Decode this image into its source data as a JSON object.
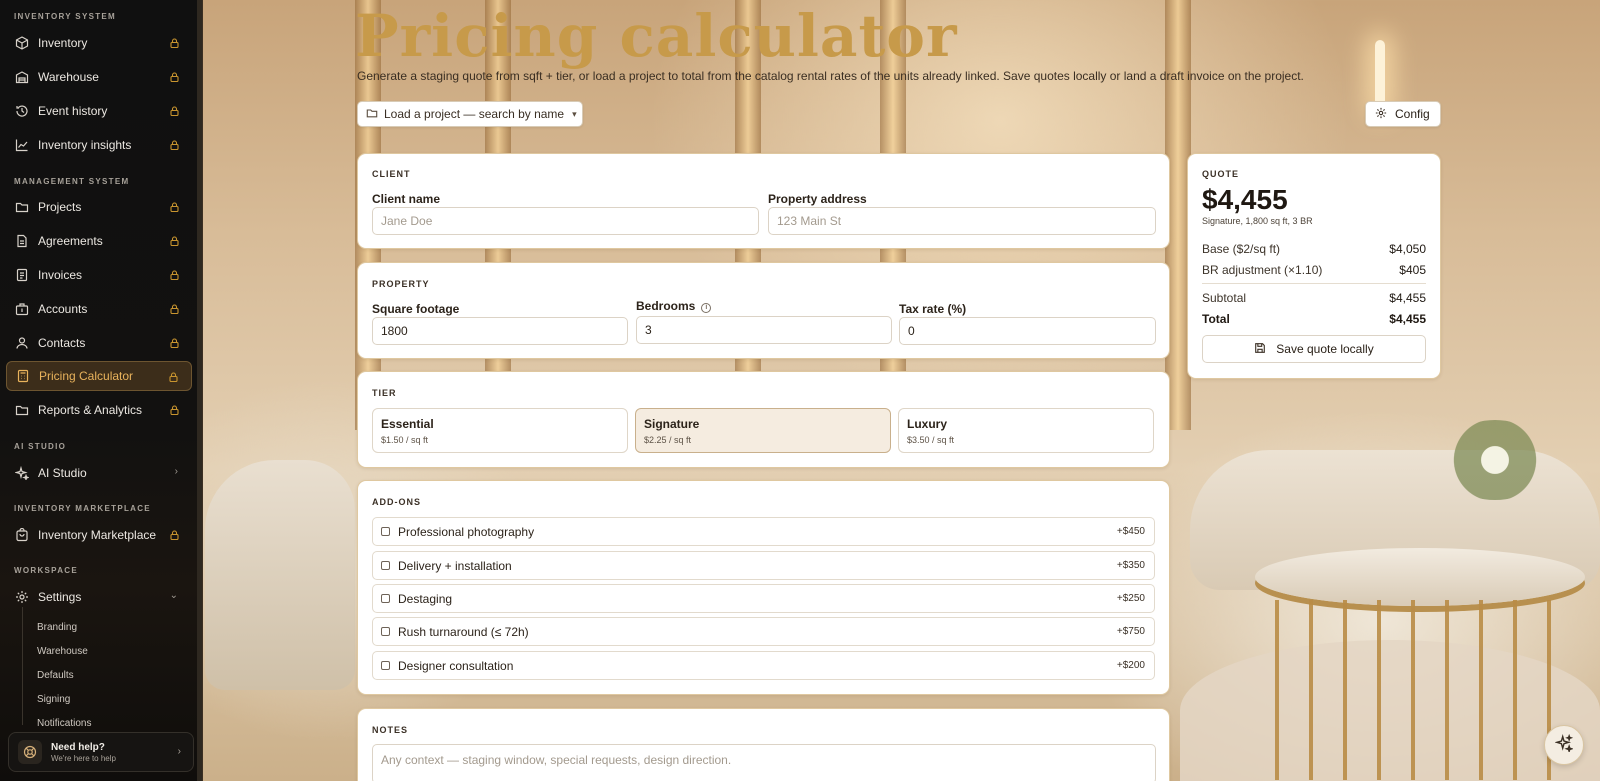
{
  "sidebar": {
    "sections": {
      "inventory_system": "INVENTORY SYSTEM",
      "management_system": "MANAGEMENT SYSTEM",
      "ai_studio": "AI STUDIO",
      "inventory_marketplace": "INVENTORY MARKETPLACE",
      "workspace": "WORKSPACE"
    },
    "inventory_items": [
      {
        "label": "Inventory",
        "icon": "box-icon",
        "locked": true
      },
      {
        "label": "Warehouse",
        "icon": "warehouse-icon",
        "locked": true
      },
      {
        "label": "Event history",
        "icon": "history-icon",
        "locked": true
      },
      {
        "label": "Inventory insights",
        "icon": "chart-line-icon",
        "locked": true
      }
    ],
    "management_items": [
      {
        "label": "Projects",
        "icon": "folder-icon",
        "locked": true
      },
      {
        "label": "Agreements",
        "icon": "document-icon",
        "locked": true
      },
      {
        "label": "Invoices",
        "icon": "receipt-icon",
        "locked": true
      },
      {
        "label": "Accounts",
        "icon": "building-icon",
        "locked": true
      },
      {
        "label": "Contacts",
        "icon": "user-icon",
        "locked": true
      },
      {
        "label": "Pricing Calculator",
        "icon": "calculator-icon",
        "locked": true,
        "active": true
      },
      {
        "label": "Reports & Analytics",
        "icon": "folder-icon",
        "locked": true
      }
    ],
    "ai_studio_item": {
      "label": "AI Studio",
      "icon": "sparkle-icon"
    },
    "marketplace_item": {
      "label": "Inventory Marketplace",
      "icon": "store-icon",
      "locked": true
    },
    "settings_item": {
      "label": "Settings",
      "icon": "gear-icon",
      "expanded": true
    },
    "settings_sub": [
      "Branding",
      "Warehouse",
      "Defaults",
      "Signing",
      "Notifications"
    ],
    "help": {
      "title": "Need help?",
      "subtitle": "We're here to help"
    }
  },
  "header": {
    "title": "Pricing calculator",
    "subtitle": "Generate a staging quote from sqft + tier, or load a project to total from the catalog rental rates of the units already linked. Save quotes locally or land a draft invoice on the project.",
    "load_project_label": "Load a project — search by name",
    "config_label": "Config"
  },
  "client": {
    "section_label": "CLIENT",
    "client_name_label": "Client name",
    "client_name_placeholder": "Jane Doe",
    "property_address_label": "Property address",
    "property_address_placeholder": "123 Main St"
  },
  "property": {
    "section_label": "PROPERTY",
    "sqft_label": "Square footage",
    "sqft_value": "1800",
    "bedrooms_label": "Bedrooms",
    "bedrooms_value": "3",
    "tax_label": "Tax rate (%)",
    "tax_value": "0"
  },
  "tier": {
    "section_label": "TIER",
    "options": [
      {
        "name": "Essential",
        "price": "$1.50 / sq ft",
        "selected": false
      },
      {
        "name": "Signature",
        "price": "$2.25 / sq ft",
        "selected": true
      },
      {
        "name": "Luxury",
        "price": "$3.50 / sq ft",
        "selected": false
      }
    ]
  },
  "addons": {
    "section_label": "ADD-ONS",
    "items": [
      {
        "label": "Professional photography",
        "price": "+$450",
        "checked": false
      },
      {
        "label": "Delivery + installation",
        "price": "+$350",
        "checked": false
      },
      {
        "label": "Destaging",
        "price": "+$250",
        "checked": false
      },
      {
        "label": "Rush turnaround (≤ 72h)",
        "price": "+$750",
        "checked": false
      },
      {
        "label": "Designer consultation",
        "price": "+$200",
        "checked": false
      }
    ]
  },
  "notes": {
    "section_label": "NOTES",
    "placeholder": "Any context — staging window, special requests, design direction."
  },
  "quote": {
    "section_label": "QUOTE",
    "total_display": "$4,455",
    "meta": "Signature, 1,800 sq ft, 3 BR",
    "rows": [
      {
        "label": "Base ($2/sq ft)",
        "value": "$4,050"
      },
      {
        "label": "BR adjustment (×1.10)",
        "value": "$405"
      }
    ],
    "subtotal_label": "Subtotal",
    "subtotal_value": "$4,455",
    "total_label": "Total",
    "total_value": "$4,455",
    "save_label": "Save quote locally"
  },
  "colors": {
    "accent_gold": "#c79a4a",
    "sidebar_bg": "#101010",
    "active_item_text": "#e9b35c"
  }
}
